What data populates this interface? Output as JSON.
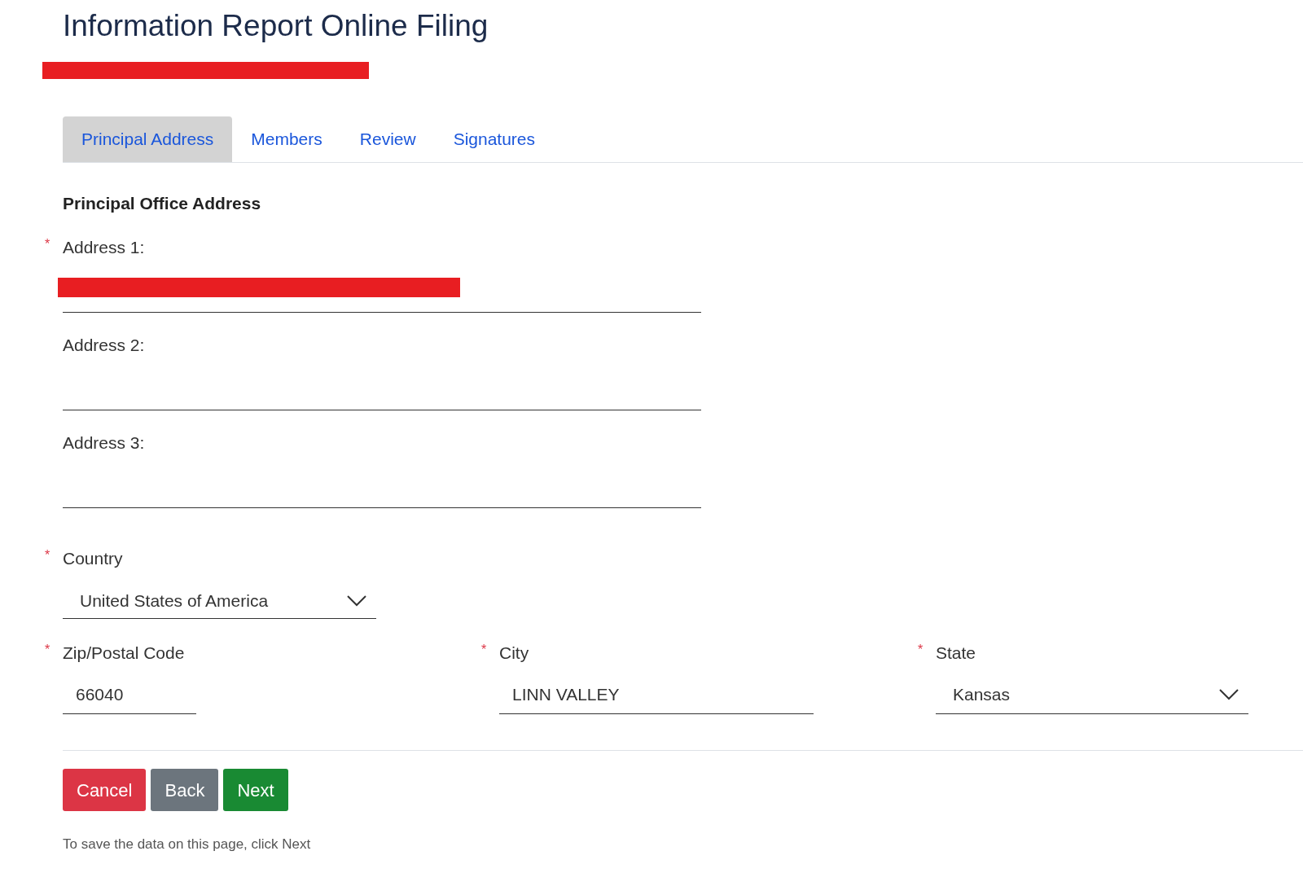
{
  "title": "Information Report Online Filing",
  "entity": {
    "redacted": true
  },
  "tabs": [
    {
      "label": "Principal Address",
      "selected": true
    },
    {
      "label": "Members",
      "selected": false
    },
    {
      "label": "Review",
      "selected": false
    },
    {
      "label": "Signatures",
      "selected": false
    }
  ],
  "section_title": "Principal Office Address",
  "fields": [
    {
      "label": "Address 1:",
      "required_mark": "*",
      "redacted": true
    },
    {
      "label": "Address 2:"
    },
    {
      "label": "Address 3:"
    }
  ],
  "country": {
    "label": "Country",
    "required_mark": "*",
    "value": "United States of America"
  },
  "location": [
    {
      "kind": "input",
      "label": "Zip/Postal Code",
      "required_mark": "*",
      "value": "66040"
    },
    {
      "kind": "input",
      "label": "City",
      "required_mark": "*",
      "value": "LINN VALLEY"
    },
    {
      "kind": "select",
      "label": "State",
      "required_mark": "*",
      "value": "Kansas"
    }
  ],
  "buttons": [
    {
      "label": "Cancel",
      "kind": "danger"
    },
    {
      "label": "Back",
      "kind": "secondary"
    },
    {
      "label": "Next",
      "kind": "success"
    }
  ],
  "note": "To save the data on this page, click Next"
}
